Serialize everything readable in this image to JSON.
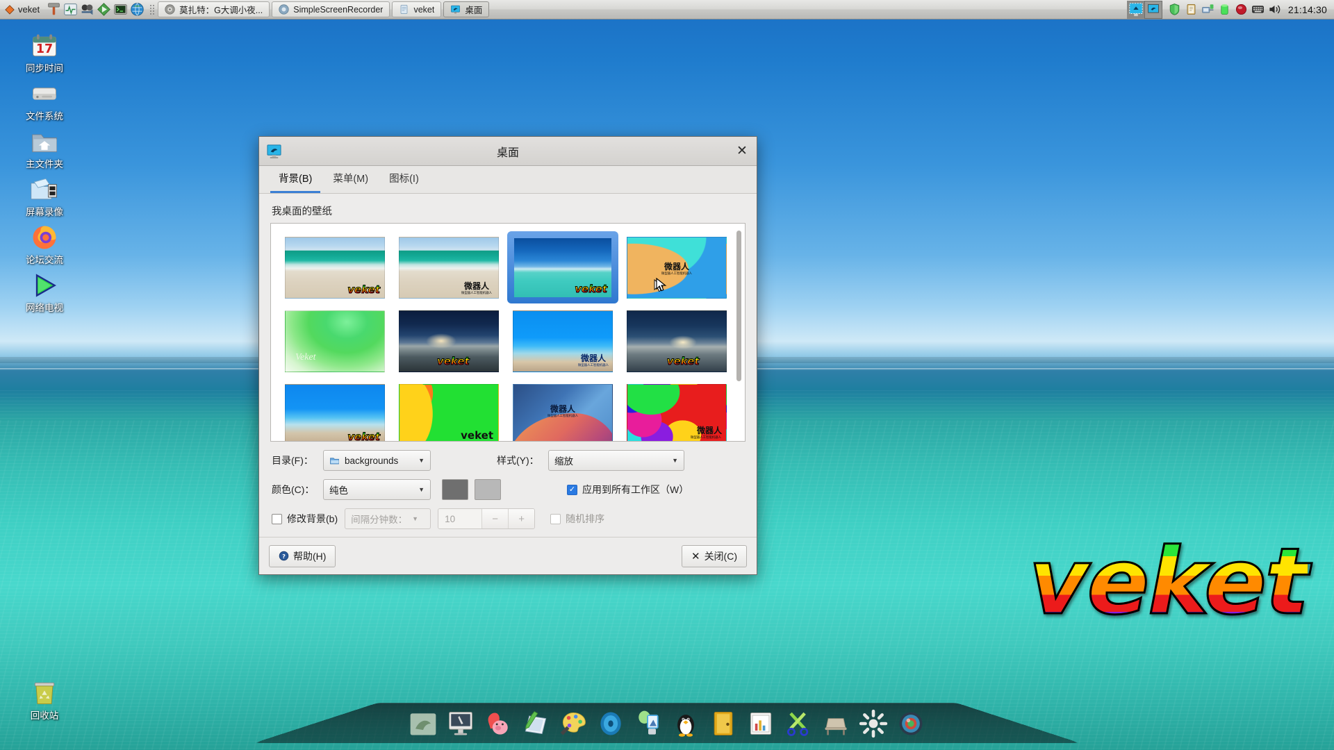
{
  "taskbar": {
    "menu_label": "veket",
    "launchers": [
      {
        "name": "hammer-icon"
      },
      {
        "name": "system-monitor-icon"
      },
      {
        "name": "video-camera-icon"
      },
      {
        "name": "media-player-icon"
      },
      {
        "name": "terminal-icon"
      },
      {
        "name": "globe-browser-icon"
      }
    ],
    "tasks": [
      {
        "label": "莫扎特：G大调小夜...",
        "icon": "audio-icon",
        "active": false
      },
      {
        "label": "SimpleScreenRecorder",
        "icon": "recorder-icon",
        "active": false
      },
      {
        "label": "veket",
        "icon": "file-manager-icon",
        "active": false
      },
      {
        "label": "桌面",
        "icon": "desktop-settings-icon",
        "active": true
      }
    ],
    "pager": [
      {
        "name": "workspace-1",
        "selected": false
      },
      {
        "name": "workspace-2",
        "selected": true
      }
    ],
    "tray": [
      {
        "name": "shield-icon"
      },
      {
        "name": "clipboard-icon"
      },
      {
        "name": "network-icon"
      },
      {
        "name": "battery-icon"
      },
      {
        "name": "record-icon"
      },
      {
        "name": "keyboard-icon"
      },
      {
        "name": "volume-icon"
      }
    ],
    "clock": "21:14:30"
  },
  "desktop_icons": [
    {
      "label": "同步时间",
      "icon": "calendar-icon",
      "badge": "17"
    },
    {
      "label": "文件系统",
      "icon": "hard-drive-icon"
    },
    {
      "label": "主文件夹",
      "icon": "home-folder-icon"
    },
    {
      "label": "屏幕录像",
      "icon": "screen-recorder-icon"
    },
    {
      "label": "论坛交流",
      "icon": "firefox-icon"
    },
    {
      "label": "网络电视",
      "icon": "play-triangle-icon"
    },
    {
      "label": "回收站",
      "icon": "trash-icon"
    }
  ],
  "wordmark": "veket",
  "dock": [
    {
      "name": "dolphin-icon"
    },
    {
      "name": "imac-icon"
    },
    {
      "name": "pink-pig-icon"
    },
    {
      "name": "notepad-pencil-icon"
    },
    {
      "name": "paint-palette-icon"
    },
    {
      "name": "blue-disc-icon"
    },
    {
      "name": "installer-icon"
    },
    {
      "name": "tux-penguin-icon"
    },
    {
      "name": "yellow-door-icon"
    },
    {
      "name": "spreadsheet-icon"
    },
    {
      "name": "green-scissors-icon"
    },
    {
      "name": "desk-chair-icon"
    },
    {
      "name": "sun-gear-icon"
    },
    {
      "name": "camera-lens-icon"
    }
  ],
  "dialog": {
    "title": "桌面",
    "close_glyph": "✕",
    "tabs": [
      {
        "label": "背景(B)",
        "selected": true
      },
      {
        "label": "菜单(M)",
        "selected": false
      },
      {
        "label": "图标(I)",
        "selected": false
      }
    ],
    "pane_label": "我桌面的壁纸",
    "wallpapers": [
      {
        "name": "beach-veket",
        "art": "art-beach",
        "mark": "veket",
        "selected": false
      },
      {
        "name": "beach-weiqiren",
        "art": "art-beach",
        "mark_cn": "微器人",
        "mark_cn_sub": "微型器人工智能机器人",
        "selected": false
      },
      {
        "name": "lagoon-veket",
        "art": "art-lagoon",
        "mark": "veket",
        "selected": true
      },
      {
        "name": "abstract-weiqiren",
        "art": "art-abstract",
        "mark_cn": "微器人",
        "mark_cn_sub": "微型器人工智能机器人",
        "selected": false,
        "has_cursor": true
      },
      {
        "name": "green-veket",
        "art": "art-green",
        "mark_script": "Veket",
        "selected": false
      },
      {
        "name": "dusk-sea-veket",
        "art": "art-dusk",
        "mark": "veket",
        "selected": false
      },
      {
        "name": "earth-weiqiren",
        "art": "art-earth",
        "mark_cn": "微器人",
        "mark_cn_sub": "微型器人工智能机器人",
        "selected": false
      },
      {
        "name": "dusk-sea-2-veket",
        "art": "art-dusk2",
        "mark": "veket",
        "selected": false
      },
      {
        "name": "earth-blue-veket",
        "art": "art-earth2",
        "mark": "veket",
        "selected": false
      },
      {
        "name": "flame-green-veket",
        "art": "art-flame",
        "mark_plain": "veket",
        "selected": false
      },
      {
        "name": "dune-weiqiren",
        "art": "art-dune",
        "mark_cn": "微器人",
        "mark_cn_sub": "微型器人工智能机器人",
        "selected": false
      },
      {
        "name": "color-blobs-weiqiren",
        "art": "art-blobs",
        "mark_cn": "微器人",
        "mark_cn_sub": "微型器人工智能机器人",
        "selected": false
      }
    ],
    "controls": {
      "folder_label": "目录(F)：",
      "folder_value": "backgrounds",
      "style_label": "样式(Y)：",
      "style_value": "缩放",
      "color_label": "颜色(C)：",
      "color_value": "纯色",
      "swatch1": "#6f6f6f",
      "swatch2": "#b8b8b8",
      "apply_all_label": "应用到所有工作区（W）",
      "apply_all_checked": true,
      "change_bg_label": "修改背景(b)",
      "change_bg_checked": false,
      "interval_label": "间隔分钟数：",
      "interval_value": "10",
      "minus_glyph": "−",
      "plus_glyph": "+",
      "random_label": "随机排序",
      "random_checked": false
    },
    "footer": {
      "help_label": "帮助(H)",
      "close_label": "关闭(C)",
      "close_icon_glyph": "✕"
    }
  },
  "accent_color": "#3b7fd4"
}
